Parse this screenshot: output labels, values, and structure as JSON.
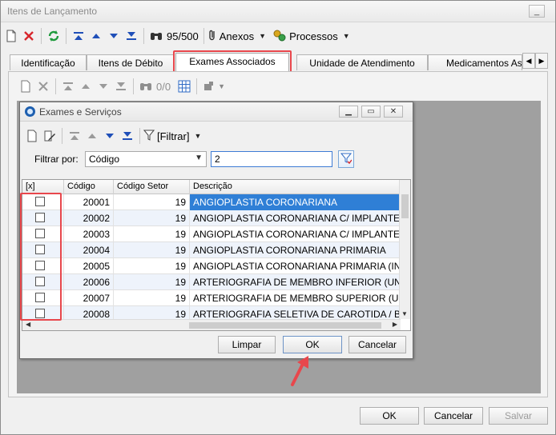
{
  "window": {
    "title": "Itens de Lançamento",
    "minimize": "_",
    "close": "✕"
  },
  "toolbar": {
    "counter": "95/500",
    "anexos": "Anexos",
    "processos": "Processos"
  },
  "tabs": [
    {
      "label": "Identificação"
    },
    {
      "label": "Itens de Débito"
    },
    {
      "label": "Exames Associados"
    },
    {
      "label": "Unidade de Atendimento"
    },
    {
      "label": "Medicamentos As"
    }
  ],
  "subtoolbar": {
    "counter": "0/0"
  },
  "dialog": {
    "title": "Exames e Serviços",
    "filter_menu": "[Filtrar]",
    "filter_label": "Filtrar por:",
    "filter_field": "Código",
    "filter_value": "2",
    "columns": [
      "[x]",
      "Código",
      "Código Setor",
      "Descrição"
    ],
    "rows": [
      {
        "codigo": "20001",
        "setor": "19",
        "descricao": "ANGIOPLASTIA CORONARIANA"
      },
      {
        "codigo": "20002",
        "setor": "19",
        "descricao": "ANGIOPLASTIA CORONARIANA C/ IMPLANTE DE D"
      },
      {
        "codigo": "20003",
        "setor": "19",
        "descricao": "ANGIOPLASTIA CORONARIANA C/ IMPLANTE DE P"
      },
      {
        "codigo": "20004",
        "setor": "19",
        "descricao": "ANGIOPLASTIA CORONARIANA PRIMARIA"
      },
      {
        "codigo": "20005",
        "setor": "19",
        "descricao": "ANGIOPLASTIA CORONARIANA PRIMARIA (INCLUI"
      },
      {
        "codigo": "20006",
        "setor": "19",
        "descricao": "ARTERIOGRAFIA DE MEMBRO INFERIOR (UNILATE"
      },
      {
        "codigo": "20007",
        "setor": "19",
        "descricao": "ARTERIOGRAFIA DE MEMBRO SUPERIOR (UNILAT"
      },
      {
        "codigo": "20008",
        "setor": "19",
        "descricao": "ARTERIOGRAFIA SELETIVA DE CAROTIDA / BILAT"
      }
    ],
    "buttons": {
      "limpar": "Limpar",
      "ok": "OK",
      "cancelar": "Cancelar"
    }
  },
  "footer": {
    "ok": "OK",
    "cancelar": "Cancelar",
    "salvar": "Salvar"
  },
  "colors": {
    "highlight": "#e8474c",
    "selection": "#2f7fd6"
  }
}
